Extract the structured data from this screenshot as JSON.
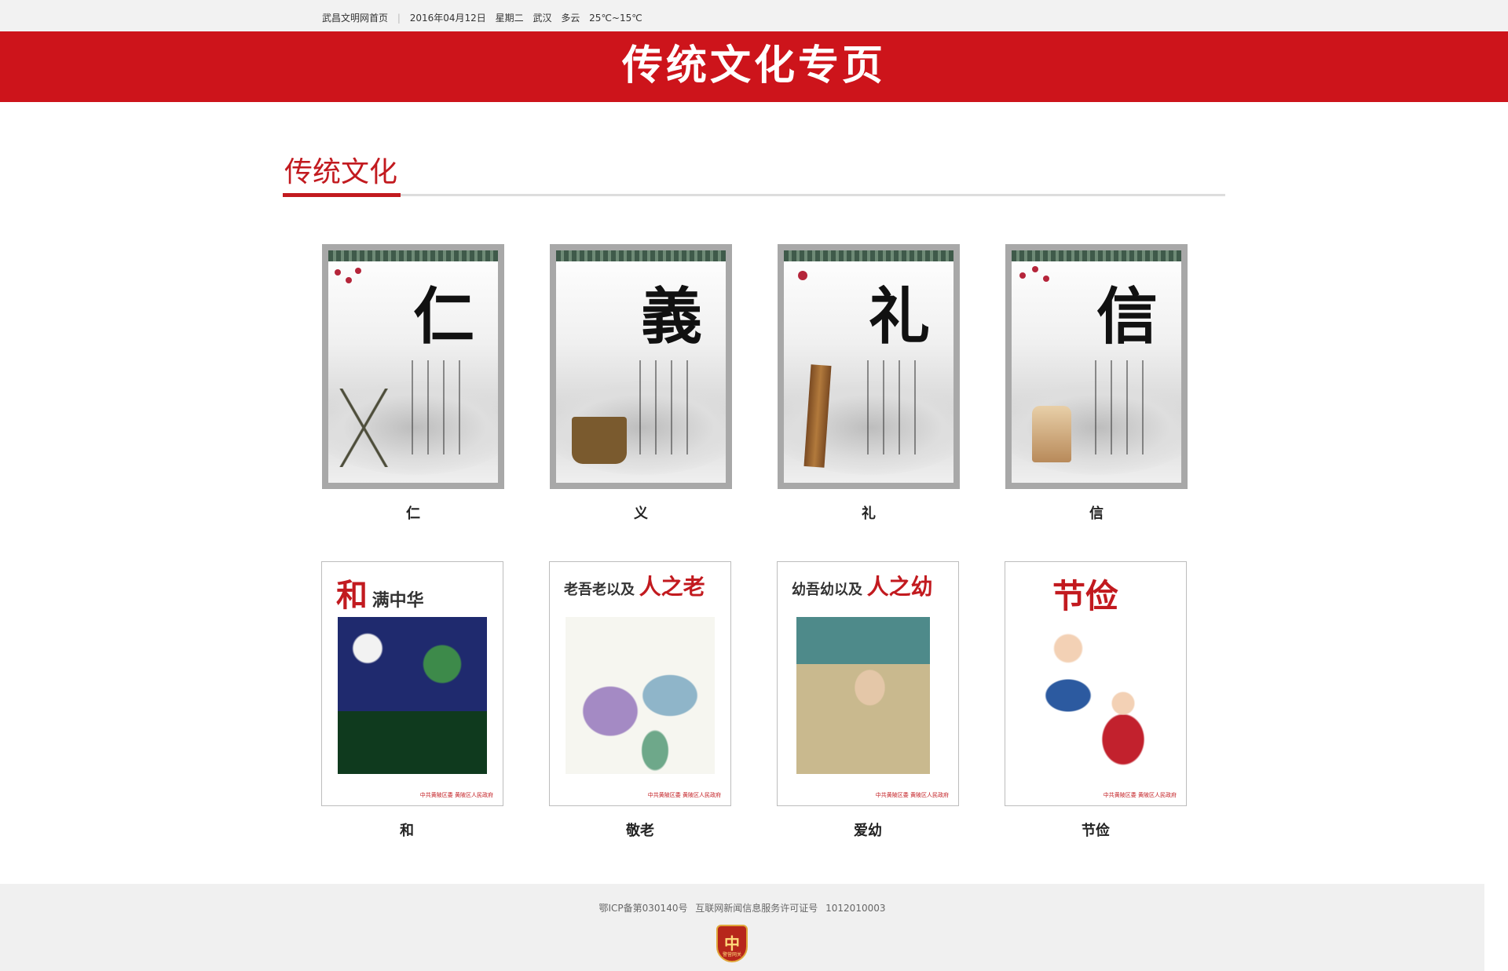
{
  "topbar": {
    "home_link": "武昌文明网首页",
    "date": "2016年04月12日",
    "weekday": "星期二",
    "city": "武汉",
    "weather": "多云",
    "temperature": "25℃~15℃"
  },
  "banner": {
    "title": "传统文化专页"
  },
  "section": {
    "title": "传统文化"
  },
  "cards_row1": [
    {
      "poster_char": "仁",
      "caption": "仁"
    },
    {
      "poster_char": "義",
      "caption": "义"
    },
    {
      "poster_char": "礼",
      "caption": "礼"
    },
    {
      "poster_char": "信",
      "caption": "信"
    }
  ],
  "cards_row2": [
    {
      "head_big": "和",
      "head_small": "满中华",
      "caption": "和",
      "foot": "中共黄陂区委 黄陂区人民政府"
    },
    {
      "head_small": "老吾老以及",
      "head_big": "人之老",
      "caption": "敬老",
      "foot": "中共黄陂区委 黄陂区人民政府"
    },
    {
      "head_small": "幼吾幼以及",
      "head_big": "人之幼",
      "caption": "爱幼",
      "foot": "中共黄陂区委 黄陂区人民政府"
    },
    {
      "head_big": "节俭",
      "caption": "节俭",
      "foot": "中共黄陂区委 黄陂区人民政府"
    }
  ],
  "footer": {
    "icp": "鄂ICP备第030140号",
    "license_label": "互联网新闻信息服务许可证号",
    "license_no": "1012010003",
    "badge_glyph": "中",
    "badge_text": "警营网关"
  },
  "colors": {
    "brand_red": "#cd141b",
    "section_red": "#c21a1f",
    "footer_bg": "#f0f0f0"
  }
}
